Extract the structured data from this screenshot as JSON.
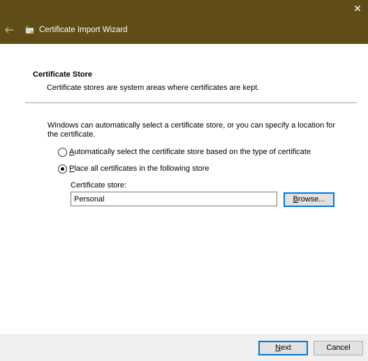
{
  "window": {
    "title": "Certificate Import Wizard",
    "close_glyph": "✕",
    "close_icon": "close-icon",
    "back_icon": "back-arrow-icon",
    "wizard_icon": "certificate-wizard-icon"
  },
  "header": {
    "title": "Certificate Store",
    "description": "Certificate stores are system areas where certificates are kept."
  },
  "body": {
    "intro": "Windows can automatically select a certificate store, or you can specify a location for the certificate.",
    "options": [
      {
        "accel": "A",
        "rest": "utomatically select the certificate store based on the type of certificate",
        "checked": false
      },
      {
        "accel": "P",
        "rest": "lace all certificates in the following store",
        "checked": true
      }
    ],
    "store_label": "Certificate store:",
    "store_value": "Personal",
    "browse_accel": "B",
    "browse_rest": "rowse..."
  },
  "footer": {
    "next_accel": "N",
    "next_rest": "ext",
    "cancel_label": "Cancel"
  },
  "colors": {
    "titlebar": "#5f4c17",
    "focus": "#0078d7"
  }
}
